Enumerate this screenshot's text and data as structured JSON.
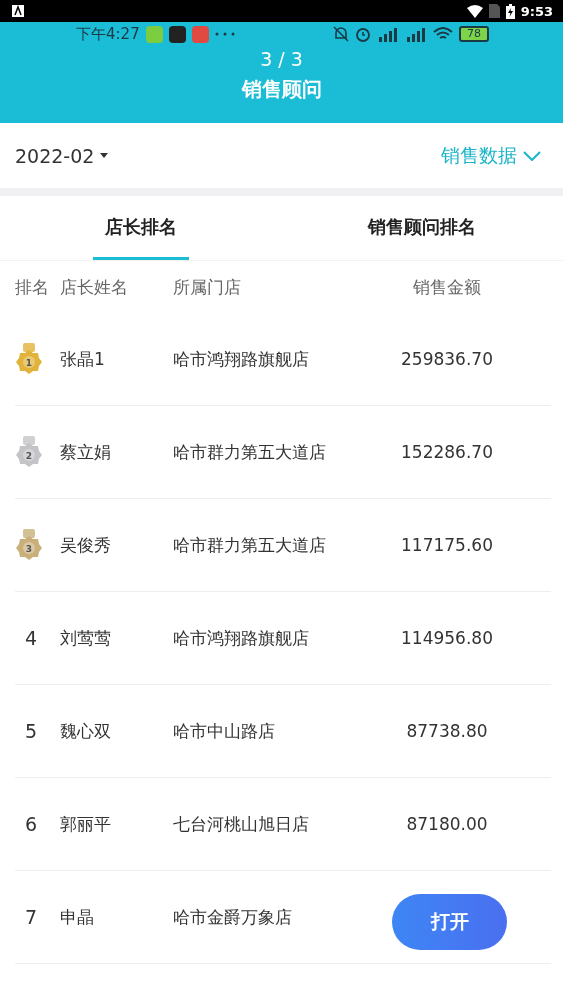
{
  "system_bar": {
    "time": "9:53"
  },
  "inner_status_bar": {
    "time": "下午4:27",
    "battery": "78"
  },
  "header": {
    "page_counter": "3 / 3",
    "title": "销售顾问"
  },
  "filter_bar": {
    "month": "2022-02",
    "data_type": "销售数据"
  },
  "tabs": [
    {
      "label": "店长排名",
      "selected": true
    },
    {
      "label": "销售顾问排名",
      "selected": false
    }
  ],
  "table": {
    "columns": [
      "排名",
      "店长姓名",
      "所属门店",
      "销售金额"
    ],
    "rows": [
      {
        "kind": "medal",
        "rank": "1",
        "color": "#e2b33a",
        "name": "张晶1",
        "store": "哈市鸿翔路旗舰店",
        "amount": "259836.70"
      },
      {
        "kind": "medal",
        "rank": "2",
        "color": "#c4c4c8",
        "name": "蔡立娟",
        "store": "哈市群力第五大道店",
        "amount": "152286.70"
      },
      {
        "kind": "medal",
        "rank": "3",
        "color": "#c9b07a",
        "name": "吴俊秀",
        "store": "哈市群力第五大道店",
        "amount": "117175.60"
      },
      {
        "kind": "number",
        "rank": "4",
        "name": "刘莺莺",
        "store": "哈市鸿翔路旗舰店",
        "amount": "114956.80"
      },
      {
        "kind": "number",
        "rank": "5",
        "name": "魏心双",
        "store": "哈市中山路店",
        "amount": "87738.80"
      },
      {
        "kind": "number",
        "rank": "6",
        "name": "郭丽平",
        "store": "七台河桃山旭日店",
        "amount": "87180.00"
      },
      {
        "kind": "number",
        "rank": "7",
        "name": "申晶",
        "store": "哈市金爵万象店"
      }
    ]
  },
  "floating_button": {
    "label": "打开"
  }
}
